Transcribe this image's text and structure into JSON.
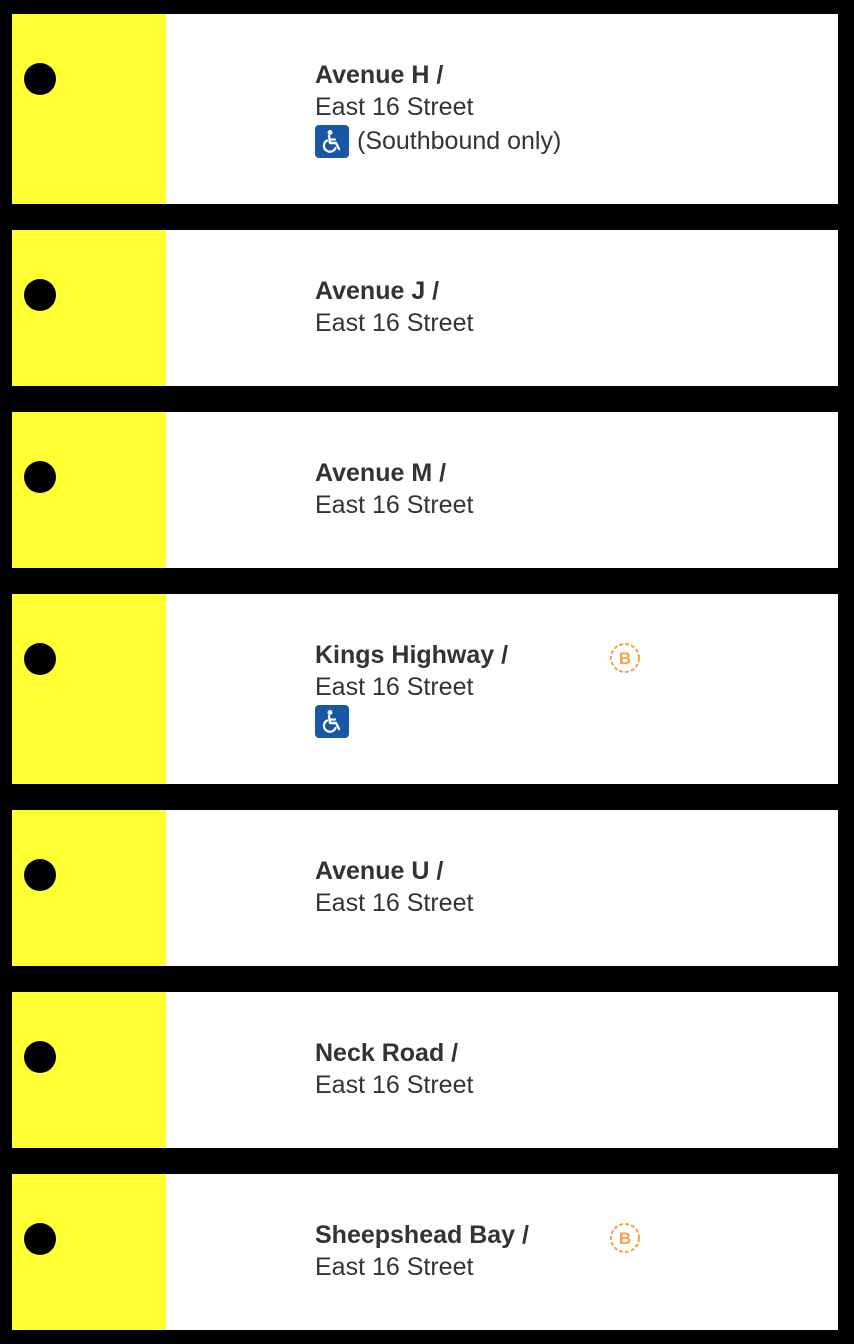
{
  "colors": {
    "line_strip": "#ffff33",
    "background": "#000000",
    "card": "#ffffff",
    "text": "#333333",
    "accessible_icon": "#1757a6",
    "bus_icon": "#f7a24a"
  },
  "stations": [
    {
      "name": "Avenue H /",
      "street": "East 16 Street",
      "accessible": true,
      "access_note": "(Southbound only)",
      "bus_transfer": false
    },
    {
      "name": "Avenue J /",
      "street": "East 16 Street",
      "accessible": false,
      "bus_transfer": false
    },
    {
      "name": "Avenue M /",
      "street": "East 16 Street",
      "accessible": false,
      "bus_transfer": false
    },
    {
      "name": "Kings Highway /",
      "street": "East 16 Street",
      "accessible": true,
      "access_note": "",
      "bus_transfer": true,
      "bus_icon": "B"
    },
    {
      "name": "Avenue U /",
      "street": "East 16 Street",
      "accessible": false,
      "bus_transfer": false
    },
    {
      "name": "Neck Road /",
      "street": "East 16 Street",
      "accessible": false,
      "bus_transfer": false
    },
    {
      "name": "Sheepshead Bay /",
      "street": "East 16 Street",
      "accessible": false,
      "bus_transfer": true,
      "bus_icon": "B"
    }
  ]
}
